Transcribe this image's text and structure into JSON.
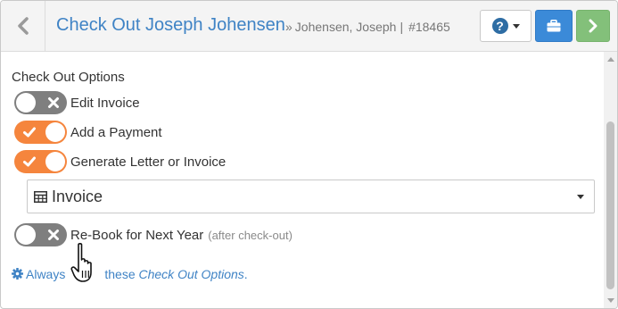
{
  "header": {
    "title": "Check Out Joseph Johensen",
    "raquo": "»",
    "client_name": "Johensen, Joseph",
    "separator": "|",
    "record_number": "#18465",
    "help_label": "?"
  },
  "options": {
    "section_title": "Check Out Options",
    "toggles": [
      {
        "label": "Edit Invoice",
        "state": "off"
      },
      {
        "label": "Add a Payment",
        "state": "on"
      },
      {
        "label": "Generate Letter or Invoice",
        "state": "on"
      },
      {
        "label": "Re-Book for Next Year",
        "note": "(after check-out)",
        "state": "off"
      }
    ],
    "document_select": {
      "value": "Invoice"
    }
  },
  "footer_link": {
    "prefix": "Always",
    "middle": "these",
    "emphasis": "Check Out Options",
    "suffix": "."
  },
  "colors": {
    "accent_blue": "#3f83c5",
    "toggle_on": "#f5853d",
    "toggle_off": "#7f7f7f",
    "briefcase_button": "#3b8ad8",
    "next_button": "#83c07a"
  },
  "icons": [
    "chevron-left-icon",
    "question-circle-icon",
    "briefcase-icon",
    "chevron-right-icon",
    "check-icon",
    "x-icon",
    "table-icon",
    "gear-icon",
    "hand-pointer-icon"
  ]
}
